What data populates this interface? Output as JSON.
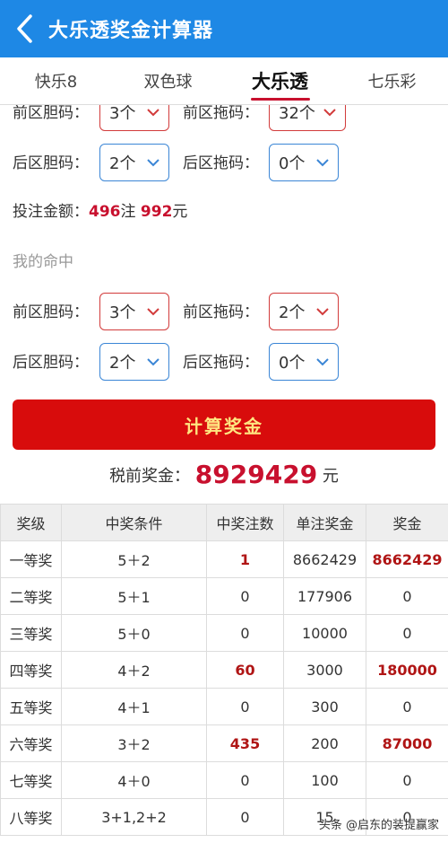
{
  "header": {
    "title": "大乐透奖金计算器"
  },
  "tabs": [
    {
      "label": "快乐8"
    },
    {
      "label": "双色球"
    },
    {
      "label": "大乐透"
    },
    {
      "label": "七乐彩"
    }
  ],
  "bet_section": {
    "front_dan_label": "前区胆码：",
    "front_dan_value": "3个",
    "front_tuo_label": "前区拖码：",
    "front_tuo_value": "32个",
    "back_dan_label": "后区胆码：",
    "back_dan_value": "2个",
    "back_tuo_label": "后区拖码：",
    "back_tuo_value": "0个",
    "amount_label": "投注金额：",
    "bets": "496",
    "bets_unit": "注",
    "money": "992",
    "money_unit": "元"
  },
  "hit_section": {
    "title": "我的命中",
    "front_dan_label": "前区胆码：",
    "front_dan_value": "3个",
    "front_tuo_label": "前区拖码：",
    "front_tuo_value": "2个",
    "back_dan_label": "后区胆码：",
    "back_dan_value": "2个",
    "back_tuo_label": "后区拖码：",
    "back_tuo_value": "0个"
  },
  "calc_button": "计算奖金",
  "total": {
    "label": "税前奖金：",
    "amount": "8929429",
    "unit": "元"
  },
  "table": {
    "headers": [
      "奖级",
      "中奖条件",
      "中奖注数",
      "单注奖金",
      "奖金"
    ],
    "rows": [
      [
        "一等奖",
        "5＋2",
        "1",
        "8662429",
        "8662429"
      ],
      [
        "二等奖",
        "5＋1",
        "0",
        "177906",
        "0"
      ],
      [
        "三等奖",
        "5＋0",
        "0",
        "10000",
        "0"
      ],
      [
        "四等奖",
        "4＋2",
        "60",
        "3000",
        "180000"
      ],
      [
        "五等奖",
        "4＋1",
        "0",
        "300",
        "0"
      ],
      [
        "六等奖",
        "3＋2",
        "435",
        "200",
        "87000"
      ],
      [
        "七等奖",
        "4＋0",
        "0",
        "100",
        "0"
      ],
      [
        "八等奖",
        "3+1,2+2",
        "0",
        "15",
        "0"
      ]
    ]
  },
  "watermark": "头条 @启东的装提赢家",
  "colors": {
    "header_bg": "#1e88e5",
    "button_bg": "#d80c0c",
    "accent_red": "#c8102e"
  }
}
